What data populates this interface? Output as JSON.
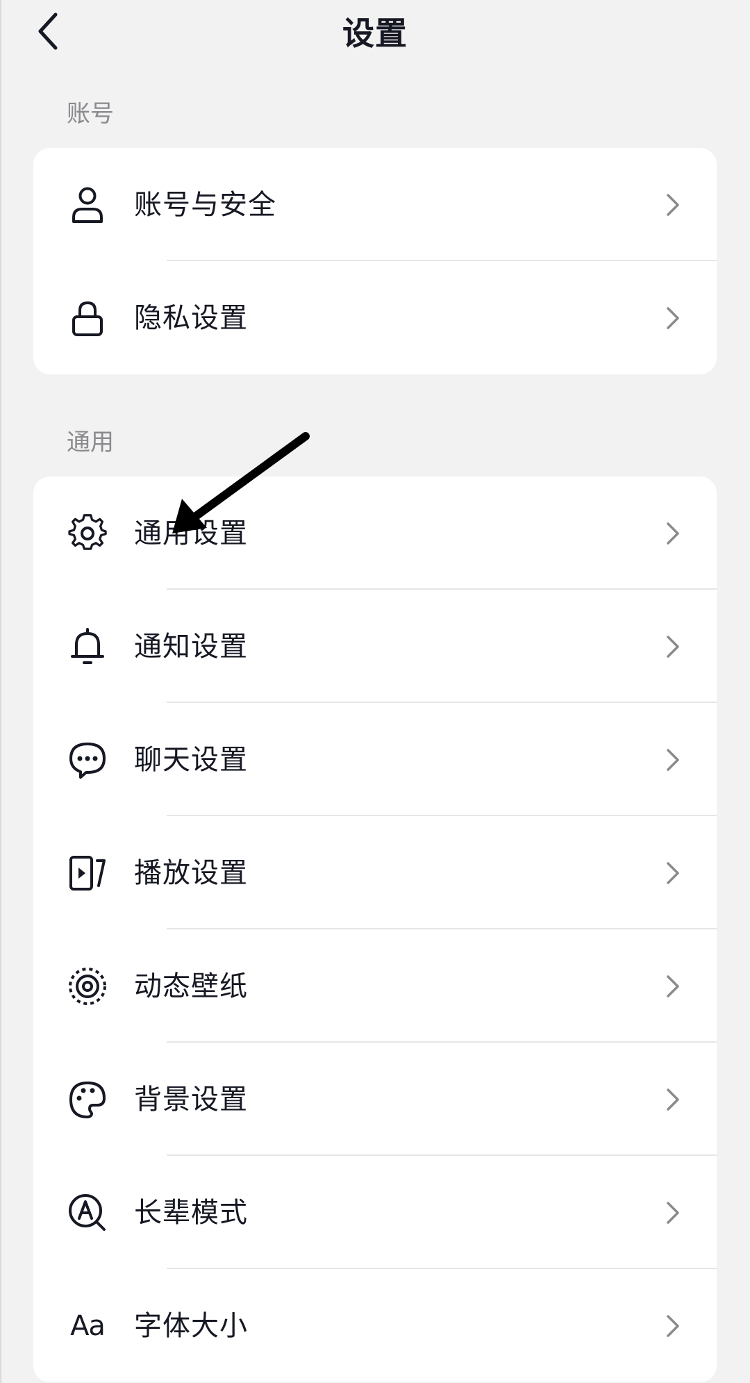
{
  "header": {
    "title": "设置"
  },
  "sections": [
    {
      "label": "账号",
      "items": [
        {
          "label": "账号与安全",
          "icon": "person-icon"
        },
        {
          "label": "隐私设置",
          "icon": "lock-icon"
        }
      ]
    },
    {
      "label": "通用",
      "items": [
        {
          "label": "通用设置",
          "icon": "gear-icon"
        },
        {
          "label": "通知设置",
          "icon": "bell-icon"
        },
        {
          "label": "聊天设置",
          "icon": "chat-bubble-icon"
        },
        {
          "label": "播放设置",
          "icon": "play-icon"
        },
        {
          "label": "动态壁纸",
          "icon": "wallpaper-icon"
        },
        {
          "label": "背景设置",
          "icon": "palette-icon"
        },
        {
          "label": "长辈模式",
          "icon": "elder-mode-icon"
        },
        {
          "label": "字体大小",
          "icon": "font-size-icon",
          "icon_text": "Aa"
        }
      ]
    }
  ],
  "colors": {
    "background": "#f2f2f2",
    "card": "#ffffff",
    "text": "#161823",
    "secondary_text": "#8a8a8e",
    "annotation_arrow": "#000000"
  }
}
